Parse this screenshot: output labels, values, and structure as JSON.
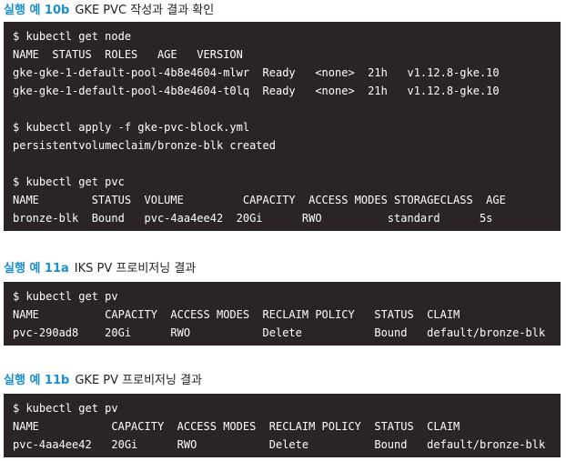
{
  "sections": [
    {
      "label": "실행 예 10b",
      "title": "GKE PVC 작성과 결과 확인",
      "lines": [
        "$ kubectl get node",
        "NAME  STATUS  ROLES   AGE   VERSION",
        "gke-gke-1-default-pool-4b8e4604-mlwr  Ready   <none>  21h   v1.12.8-gke.10",
        "gke-gke-1-default-pool-4b8e4604-t0lq  Ready   <none>  21h   v1.12.8-gke.10",
        "",
        "$ kubectl apply -f gke-pvc-block.yml",
        "persistentvolumeclaim/bronze-blk created",
        "",
        "$ kubectl get pvc",
        "NAME        STATUS  VOLUME         CAPACITY  ACCESS MODES STORAGECLASS  AGE",
        "bronze-blk  Bound   pvc-4aa4ee42  20Gi      RWO          standard      5s"
      ]
    },
    {
      "label": "실행 예 11a",
      "title": "IKS PV 프로비저닝 결과",
      "lines": [
        "$ kubectl get pv",
        "NAME          CAPACITY  ACCESS MODES  RECLAIM POLICY   STATUS  CLAIM",
        "pvc-290ad8    20Gi      RWO           Delete           Bound   default/bronze-blk"
      ]
    },
    {
      "label": "실행 예 11b",
      "title": "GKE PV 프로비저닝 결과",
      "lines": [
        "$ kubectl get pv",
        "NAME           CAPACITY  ACCESS MODES  RECLAIM POLICY  STATUS  CLAIM",
        "pvc-4aa4ee42   20Gi      RWO           Delete          Bound   default/bronze-blk"
      ]
    }
  ]
}
